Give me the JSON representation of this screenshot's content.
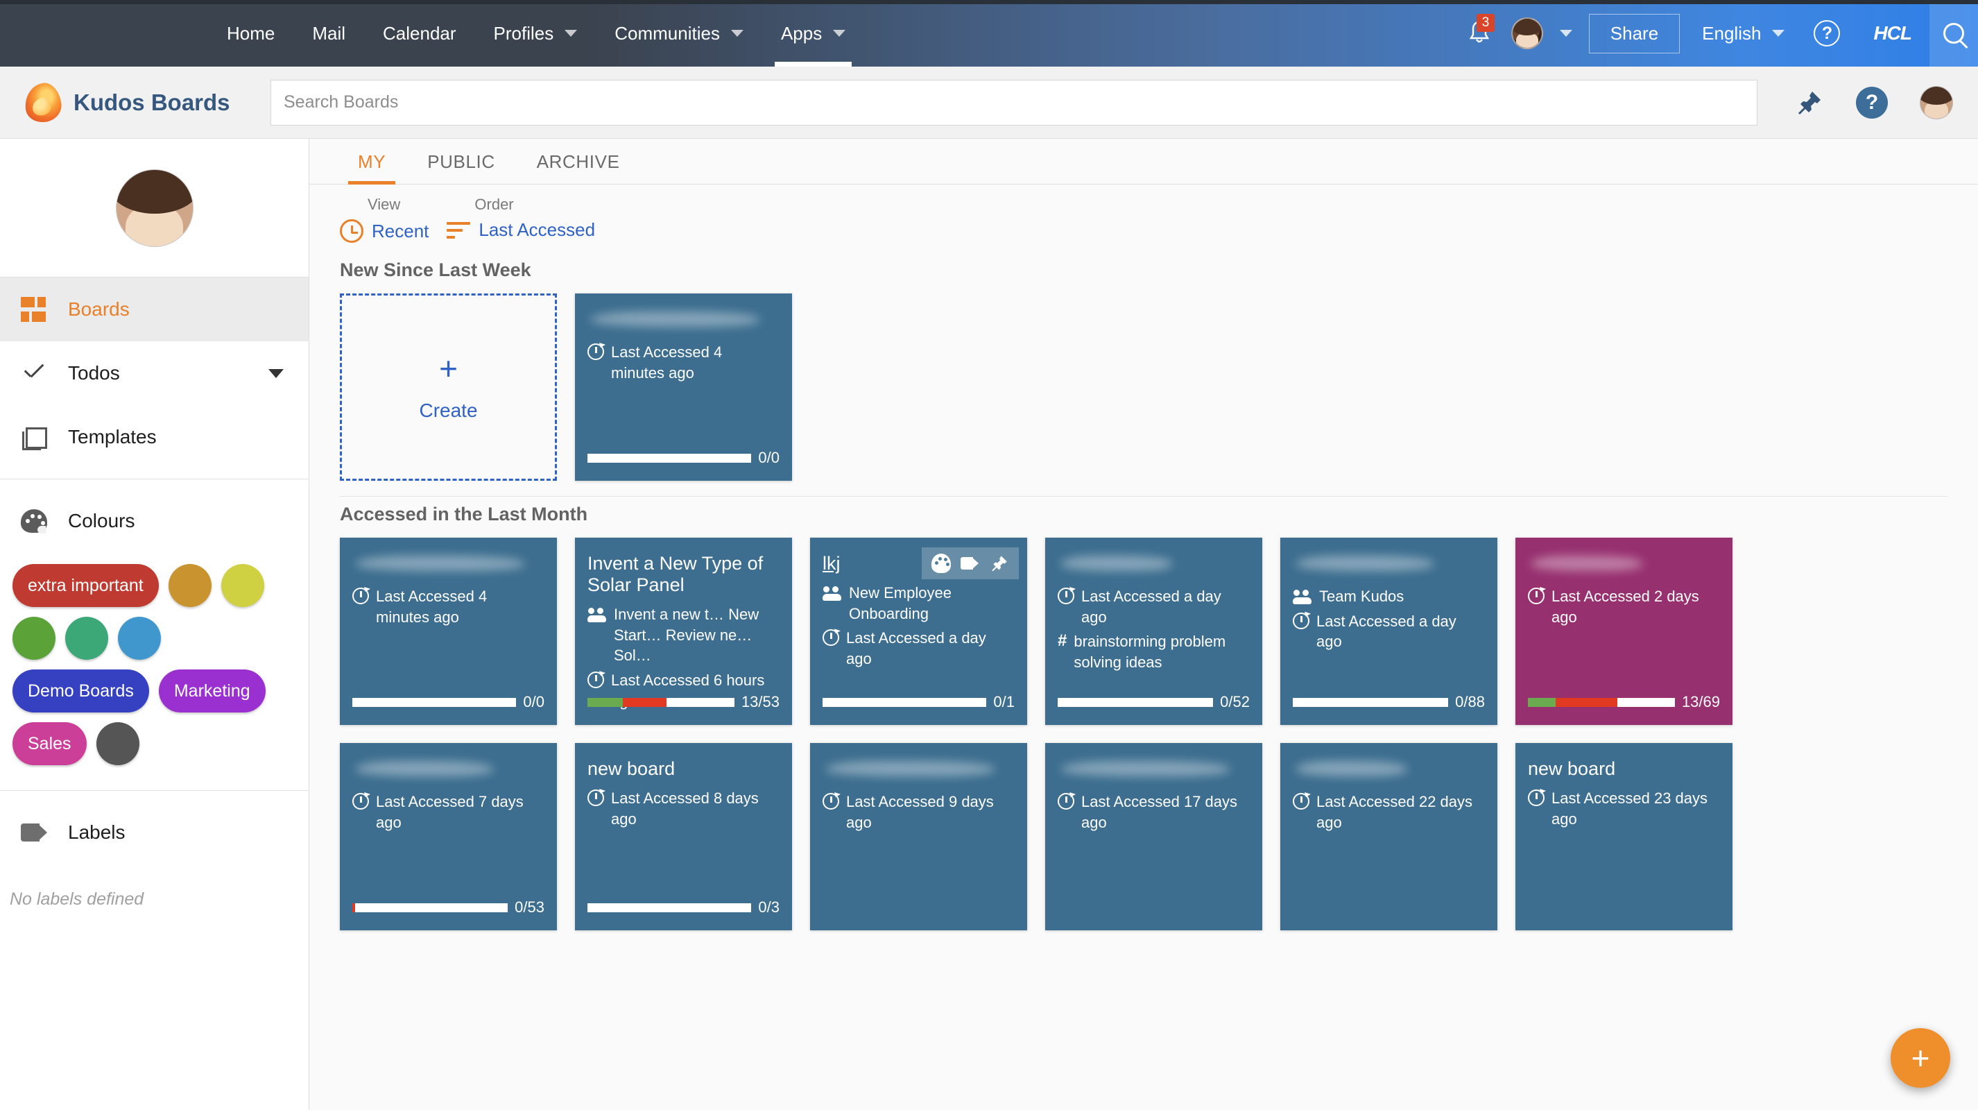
{
  "topbar": {
    "nav": [
      {
        "label": "Home",
        "has_caret": false,
        "active": false
      },
      {
        "label": "Mail",
        "has_caret": false,
        "active": false
      },
      {
        "label": "Calendar",
        "has_caret": false,
        "active": false
      },
      {
        "label": "Profiles",
        "has_caret": true,
        "active": false
      },
      {
        "label": "Communities",
        "has_caret": true,
        "active": false
      },
      {
        "label": "Apps",
        "has_caret": true,
        "active": true
      }
    ],
    "notification_count": "3",
    "share_label": "Share",
    "language_label": "English",
    "help_glyph": "?",
    "brand_logo_text": "HCL"
  },
  "appheader": {
    "brand": "Kudos Boards",
    "search_placeholder": "Search Boards",
    "help_glyph": "?"
  },
  "sidebar": {
    "items": [
      {
        "label": "Boards",
        "icon": "grid-icon",
        "active": true,
        "caret": false
      },
      {
        "label": "Todos",
        "icon": "check-icon",
        "active": false,
        "caret": true
      },
      {
        "label": "Templates",
        "icon": "templates-icon",
        "active": false,
        "caret": false
      }
    ],
    "colours_label": "Colours",
    "colours": [
      {
        "label": "extra important",
        "color": "#bf3b32",
        "type": "label"
      },
      {
        "label": "",
        "color": "#c9932f",
        "type": "dot"
      },
      {
        "label": "",
        "color": "#cfd142",
        "type": "dot"
      },
      {
        "label": "",
        "color": "#5ba338",
        "type": "dot"
      },
      {
        "label": "",
        "color": "#3da877",
        "type": "dot"
      },
      {
        "label": "",
        "color": "#4097ce",
        "type": "dot"
      },
      {
        "label": "Demo Boards",
        "color": "#3541c0",
        "type": "label"
      },
      {
        "label": "Marketing",
        "color": "#9b30d0",
        "type": "label"
      },
      {
        "label": "Sales",
        "color": "#cc3f99",
        "type": "label"
      },
      {
        "label": "",
        "color": "#555555",
        "type": "dot"
      }
    ],
    "labels_label": "Labels",
    "labels_empty": "No labels defined"
  },
  "main": {
    "tabs": [
      {
        "label": "MY",
        "active": true
      },
      {
        "label": "PUBLIC",
        "active": false
      },
      {
        "label": "ARCHIVE",
        "active": false
      }
    ],
    "controls": {
      "view_caption": "View",
      "view_value": "Recent",
      "order_caption": "Order",
      "order_value": "Last Accessed"
    },
    "create_card": {
      "plus": "+",
      "label": "Create"
    },
    "sections": [
      {
        "title": "New Since Last Week",
        "has_create_card": true,
        "cards": [
          {
            "title": "",
            "title_blurred": true,
            "blur_size": "wide",
            "members": "",
            "hashtag": "",
            "accessed": "Last Accessed 4 minutes ago",
            "progress_label": "0/0",
            "segments": [],
            "bg": "#3d6e8f",
            "tools": false,
            "linked": false
          }
        ]
      },
      {
        "title": "Accessed in the Last Month",
        "has_create_card": false,
        "cards": [
          {
            "title": "",
            "title_blurred": true,
            "blur_size": "wide",
            "members": "",
            "hashtag": "",
            "accessed": "Last Accessed 4 minutes ago",
            "progress_label": "0/0",
            "segments": [],
            "bg": "#3d6e8f",
            "tools": false,
            "linked": false
          },
          {
            "title": "Invent a New Type of Solar Panel",
            "title_blurred": false,
            "members": "Invent a new t…   New Start…   Review ne…   Sol…",
            "hashtag": "",
            "accessed": "Last Accessed 6 hours ago",
            "progress_label": "13/53",
            "segments": [
              {
                "color": "#6aab4f",
                "pct": 24
              },
              {
                "color": "#e23a22",
                "pct": 30
              }
            ],
            "bg": "#3d6e8f",
            "tools": false,
            "linked": false
          },
          {
            "title": "lkj",
            "title_blurred": false,
            "members": "New Employee Onboarding",
            "hashtag": "",
            "accessed": "Last Accessed a day ago",
            "progress_label": "0/1",
            "segments": [],
            "bg": "#3d6e8f",
            "tools": true,
            "linked": true
          },
          {
            "title": "",
            "title_blurred": true,
            "blur_size": "short",
            "members": "",
            "hashtag": "brainstorming problem solving ideas",
            "accessed": "Last Accessed a day ago",
            "progress_label": "0/52",
            "segments": [],
            "bg": "#3d6e8f",
            "tools": false,
            "linked": false
          },
          {
            "title": "",
            "title_blurred": true,
            "blur_size": "mid",
            "members": "Team Kudos",
            "hashtag": "",
            "accessed": "Last Accessed a day ago",
            "progress_label": "0/88",
            "segments": [],
            "bg": "#3d6e8f",
            "tools": false,
            "linked": false
          },
          {
            "title": "",
            "title_blurred": true,
            "blur_size": "short",
            "members": "",
            "hashtag": "",
            "accessed": "Last Accessed 2 days ago",
            "progress_label": "13/69",
            "segments": [
              {
                "color": "#6aab4f",
                "pct": 19
              },
              {
                "color": "#e23a22",
                "pct": 42
              }
            ],
            "bg": "#97306f",
            "tools": false,
            "linked": false
          },
          {
            "title": "",
            "title_blurred": true,
            "blur_size": "mid",
            "members": "",
            "hashtag": "",
            "accessed": "Last Accessed 7 days ago",
            "progress_label": "0/53",
            "segments": [
              {
                "color": "#e23a22",
                "pct": 2
              }
            ],
            "bg": "#3d6e8f",
            "tools": false,
            "linked": false
          },
          {
            "title": "new board",
            "title_blurred": false,
            "members": "",
            "hashtag": "",
            "accessed": "Last Accessed 8 days ago",
            "progress_label": "0/3",
            "segments": [],
            "bg": "#3d6e8f",
            "tools": false,
            "linked": false
          },
          {
            "title": "",
            "title_blurred": true,
            "blur_size": "wide",
            "members": "",
            "hashtag": "",
            "accessed": "Last Accessed 9 days ago",
            "progress_label": "",
            "segments": [],
            "bg": "#3d6e8f",
            "tools": false,
            "linked": false
          },
          {
            "title": "",
            "title_blurred": true,
            "blur_size": "wide",
            "members": "",
            "hashtag": "",
            "accessed": "Last Accessed 17 days ago",
            "progress_label": "",
            "segments": [],
            "bg": "#3d6e8f",
            "tools": false,
            "linked": false
          },
          {
            "title": "",
            "title_blurred": true,
            "blur_size": "short",
            "members": "",
            "hashtag": "",
            "accessed": "Last Accessed 22 days ago",
            "progress_label": "",
            "segments": [],
            "bg": "#3d6e8f",
            "tools": false,
            "linked": false
          },
          {
            "title": "new board",
            "title_blurred": false,
            "members": "",
            "hashtag": "",
            "accessed": "Last Accessed 23 days ago",
            "progress_label": "",
            "segments": [],
            "bg": "#3d6e8f",
            "tools": false,
            "linked": false
          }
        ]
      }
    ],
    "fab_glyph": "+"
  },
  "colors": {
    "accent_orange": "#e8812a",
    "link_blue": "#2f62c4",
    "card_blue": "#3d6e8f",
    "card_magenta": "#97306f",
    "fab_orange": "#ef8f2c"
  }
}
